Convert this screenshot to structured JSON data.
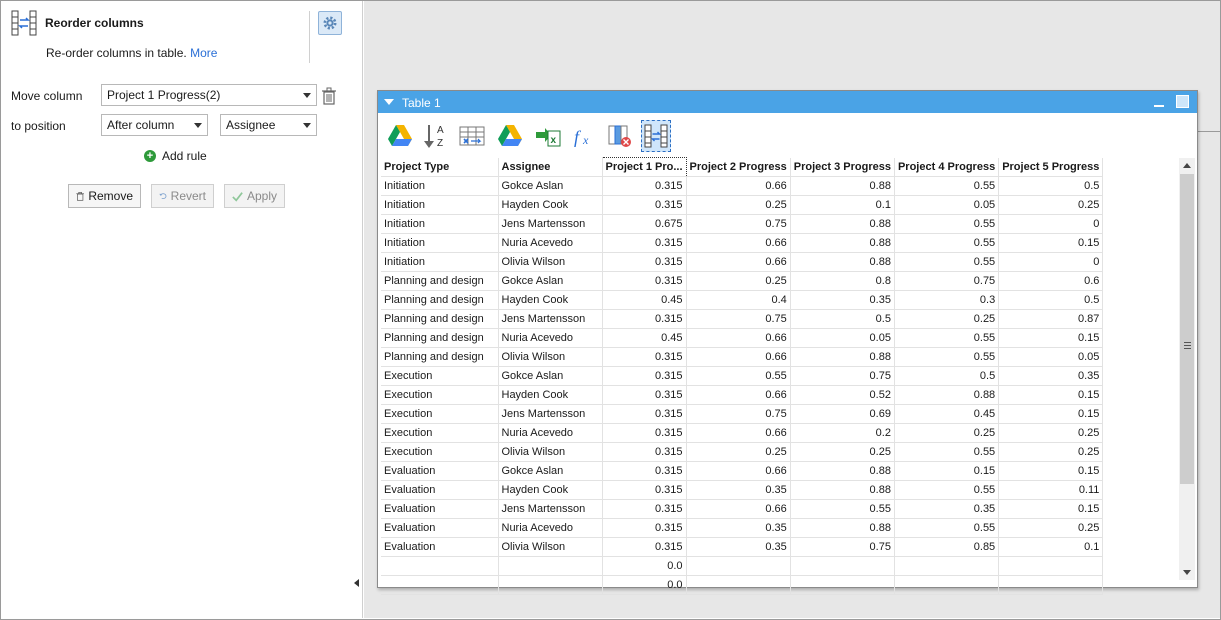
{
  "panel": {
    "title": "Reorder columns",
    "description": "Re-order columns in table.",
    "more_link": "More",
    "move_column_label": "Move column",
    "move_column_value": "Project 1 Progress(2)",
    "to_position_label": "to position",
    "position_value": "After column",
    "target_column_value": "Assignee",
    "add_rule_label": "Add rule",
    "remove_label": "Remove",
    "revert_label": "Revert",
    "apply_label": "Apply"
  },
  "table_window": {
    "title": "Table 1"
  },
  "toolbar_icons": [
    "google-drive-icon",
    "sort-az-icon",
    "table-split-icon",
    "google-drive-icon",
    "export-excel-icon",
    "formula-icon",
    "delete-column-icon",
    "reorder-columns-icon"
  ],
  "table": {
    "columns": [
      "Project Type",
      "Assignee",
      "Project 1 Pro...",
      "Project 2 Progress",
      "Project 3 Progress",
      "Project 4 Progress",
      "Project 5 Progress"
    ],
    "rows": [
      [
        "Initiation",
        "Gokce Aslan",
        "0.315",
        "0.66",
        "0.88",
        "0.55",
        "0.5"
      ],
      [
        "Initiation",
        "Hayden Cook",
        "0.315",
        "0.25",
        "0.1",
        "0.05",
        "0.25"
      ],
      [
        "Initiation",
        "Jens Martensson",
        "0.675",
        "0.75",
        "0.88",
        "0.55",
        "0"
      ],
      [
        "Initiation",
        "Nuria Acevedo",
        "0.315",
        "0.66",
        "0.88",
        "0.55",
        "0.15"
      ],
      [
        "Initiation",
        "Olivia Wilson",
        "0.315",
        "0.66",
        "0.88",
        "0.55",
        "0"
      ],
      [
        "Planning and design",
        "Gokce Aslan",
        "0.315",
        "0.25",
        "0.8",
        "0.75",
        "0.6"
      ],
      [
        "Planning and design",
        "Hayden Cook",
        "0.45",
        "0.4",
        "0.35",
        "0.3",
        "0.5"
      ],
      [
        "Planning and design",
        "Jens Martensson",
        "0.315",
        "0.75",
        "0.5",
        "0.25",
        "0.87"
      ],
      [
        "Planning and design",
        "Nuria Acevedo",
        "0.45",
        "0.66",
        "0.05",
        "0.55",
        "0.15"
      ],
      [
        "Planning and design",
        "Olivia Wilson",
        "0.315",
        "0.66",
        "0.88",
        "0.55",
        "0.05"
      ],
      [
        "Execution",
        "Gokce Aslan",
        "0.315",
        "0.55",
        "0.75",
        "0.5",
        "0.35"
      ],
      [
        "Execution",
        "Hayden Cook",
        "0.315",
        "0.66",
        "0.52",
        "0.88",
        "0.15"
      ],
      [
        "Execution",
        "Jens Martensson",
        "0.315",
        "0.75",
        "0.69",
        "0.45",
        "0.15"
      ],
      [
        "Execution",
        "Nuria Acevedo",
        "0.315",
        "0.66",
        "0.2",
        "0.25",
        "0.25"
      ],
      [
        "Execution",
        "Olivia Wilson",
        "0.315",
        "0.25",
        "0.25",
        "0.55",
        "0.25"
      ],
      [
        "Evaluation",
        "Gokce Aslan",
        "0.315",
        "0.66",
        "0.88",
        "0.15",
        "0.15"
      ],
      [
        "Evaluation",
        "Hayden Cook",
        "0.315",
        "0.35",
        "0.88",
        "0.55",
        "0.11"
      ],
      [
        "Evaluation",
        "Jens Martensson",
        "0.315",
        "0.66",
        "0.55",
        "0.35",
        "0.15"
      ],
      [
        "Evaluation",
        "Nuria Acevedo",
        "0.315",
        "0.35",
        "0.88",
        "0.55",
        "0.25"
      ],
      [
        "Evaluation",
        "Olivia Wilson",
        "0.315",
        "0.35",
        "0.75",
        "0.85",
        "0.1"
      ],
      [
        "",
        "",
        "0.0",
        "",
        "",
        "",
        ""
      ],
      [
        "",
        "",
        "0.0",
        "",
        "",
        "",
        ""
      ]
    ]
  },
  "colors": {
    "title_bar": "#4aa3e6",
    "link": "#2a6fd6",
    "add_rule_green": "#2e9a3a",
    "workspace_bg": "#e7e7e7"
  }
}
